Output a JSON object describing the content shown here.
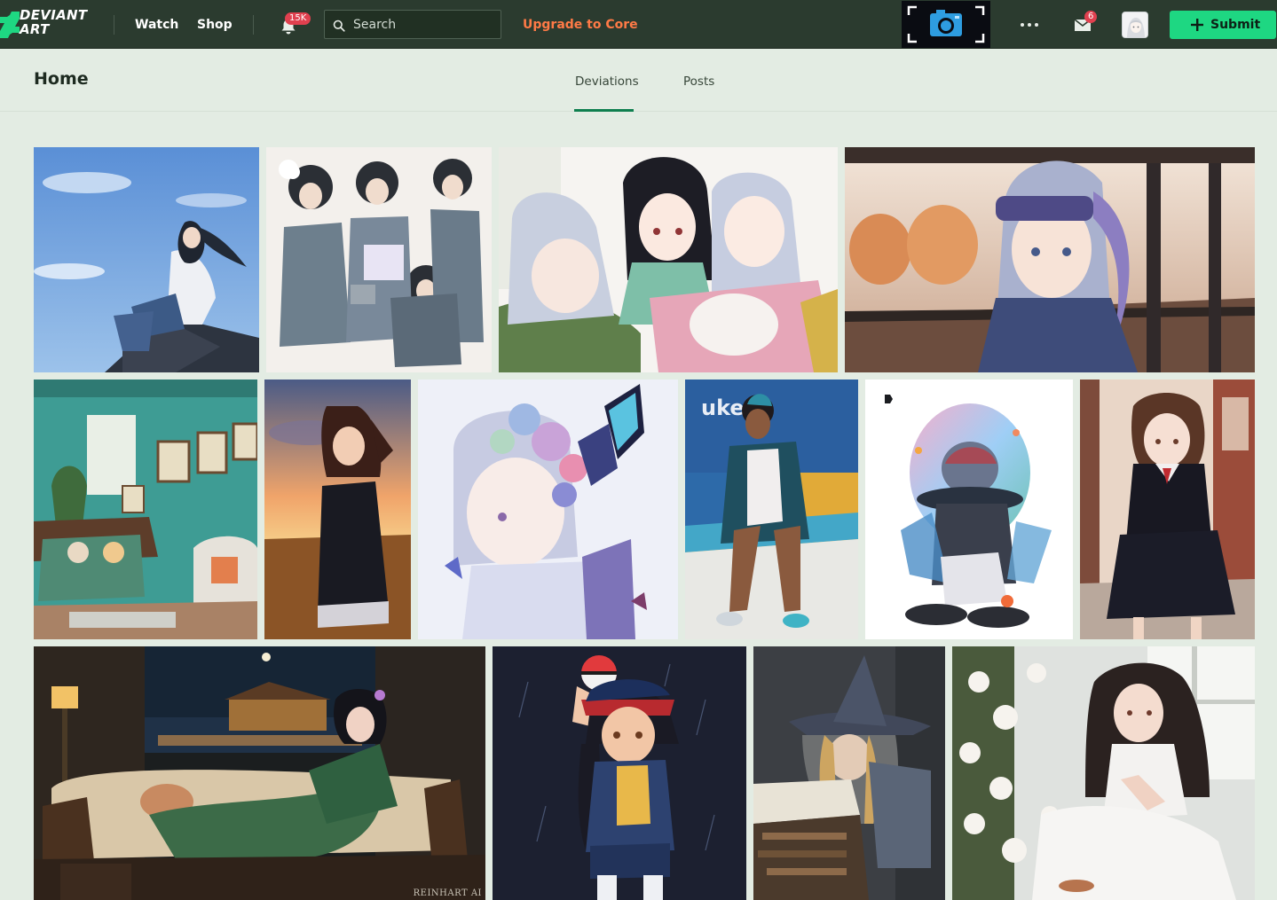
{
  "header": {
    "logo": {
      "line1": "DEVIANT",
      "line2": "ART"
    },
    "nav": {
      "watch": "Watch",
      "shop": "Shop"
    },
    "notifications": {
      "badge": "15K"
    },
    "search": {
      "placeholder": "Search"
    },
    "upgrade": "Upgrade to Core",
    "messages": {
      "badge": "6"
    },
    "submit": "Submit"
  },
  "page": {
    "title": "Home",
    "tabs": [
      {
        "label": "Deviations",
        "active": true
      },
      {
        "label": "Posts",
        "active": false
      }
    ]
  },
  "gallery": {
    "watermark_text": "REINHART AI"
  },
  "colors": {
    "topbar": "#2b3b2f",
    "accent_green": "#1ed782",
    "upgrade_orange": "#ff7a46",
    "badge_red": "#e0404f",
    "page_bg": "#e3ece3"
  }
}
